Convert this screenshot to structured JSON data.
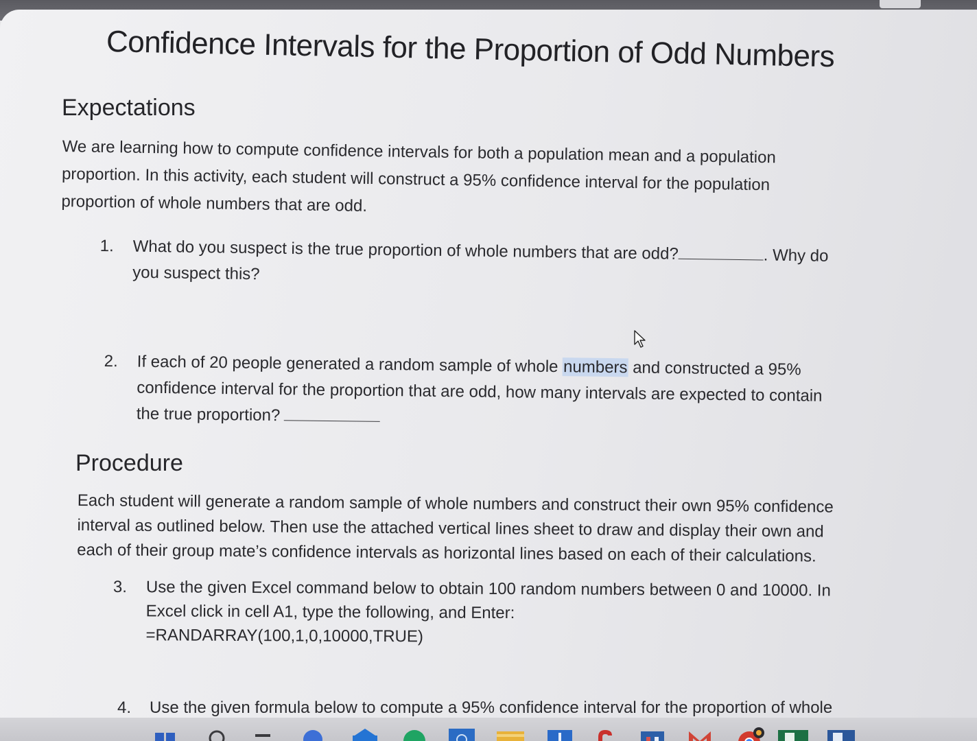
{
  "document": {
    "title": "Confidence Intervals for the Proportion of Odd Numbers",
    "expectations": {
      "heading": "Expectations",
      "lines": [
        "We are learning how to compute confidence intervals for both a population mean and a population",
        "proportion. In this activity, each student will construct a 95% confidence interval for the population",
        "proportion of whole numbers that are odd."
      ]
    },
    "questions": {
      "q1": {
        "number": "1.",
        "text_before_blank": "What do you suspect is the true proportion of whole numbers that are odd?",
        "text_after_blank": ". Why do",
        "line2": "you suspect this?"
      },
      "q2": {
        "number": "2.",
        "line1_a": "If each of 20 people generated a random sample of whole ",
        "line1_highlight": "numbers",
        "line1_b": " and constructed a 95%",
        "line2": "confidence interval for the proportion that are odd, how many intervals are expected to contain",
        "line3": "the true proportion?"
      }
    },
    "procedure": {
      "heading": "Procedure",
      "lines": [
        "Each student will generate a random sample of whole numbers and construct their own 95% confidence",
        "interval as outlined below. Then use the attached vertical lines sheet to draw and display their own and",
        "each of their group mate’s confidence intervals as horizontal lines based on each of their calculations."
      ]
    },
    "steps": {
      "s3": {
        "number": "3.",
        "line1": "Use the given Excel command below to obtain 100 random numbers between 0 and 10000. In",
        "line2": "Excel click in cell A1, type the following, and Enter:",
        "line3": "=RANDARRAY(100,1,0,10000,TRUE)"
      },
      "s4": {
        "number": "4.",
        "line1": "Use the given formula below to compute a 95% confidence interval for the proportion of whole"
      }
    }
  },
  "taskbar": {
    "icons": [
      {
        "name": "start-icon",
        "color": "#2f5fbf"
      },
      {
        "name": "search-icon",
        "color": "#3a3a3e"
      },
      {
        "name": "task-view-icon",
        "color": "#3a3a3e"
      },
      {
        "name": "app-icon",
        "color": "#3d6fd6"
      },
      {
        "name": "browser-icon",
        "color": "#2474d4"
      },
      {
        "name": "chrome-icon",
        "color": "#1fa463"
      },
      {
        "name": "store-icon",
        "color": "#2b6cc4"
      },
      {
        "name": "folder-icon",
        "color": "#e8b23a"
      },
      {
        "name": "tablet-icon",
        "color": "#2a6ac8"
      },
      {
        "name": "app-icon-red",
        "color": "#c9302c"
      },
      {
        "name": "calendar-icon",
        "color": "#2c5fa8"
      },
      {
        "name": "gmail-icon",
        "color": "#d04437"
      },
      {
        "name": "chrome-icon-2",
        "color": "#d23b2e"
      },
      {
        "name": "excel-icon",
        "color": "#1d7044"
      },
      {
        "name": "word-icon",
        "color": "#2b579a"
      }
    ]
  }
}
